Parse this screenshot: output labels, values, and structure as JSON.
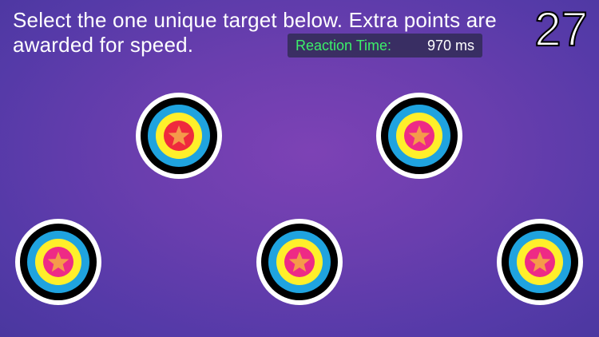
{
  "instructions": "Select the one unique target below. Extra points are awarded for speed.",
  "score": "27",
  "reaction": {
    "label": "Reaction Time:",
    "value": "970 ms"
  },
  "colors": {
    "ring_white": "#ffffff",
    "ring_black": "#000000",
    "ring_blue": "#1fa3df",
    "ring_yellow": "#ffef2a",
    "center_red": "#ef2a3d",
    "center_pink": "#ee2a86",
    "star_red": "#ef2a3d",
    "star_orange": "#f59a4a",
    "reaction_label": "#3cf06a"
  },
  "targets": [
    {
      "id": "target-1",
      "center": "center_red",
      "star": "star_orange",
      "unique": true
    },
    {
      "id": "target-2",
      "center": "center_pink",
      "star": "star_orange",
      "unique": false
    },
    {
      "id": "target-3",
      "center": "center_pink",
      "star": "star_orange",
      "unique": false
    },
    {
      "id": "target-4",
      "center": "center_pink",
      "star": "star_orange",
      "unique": false
    },
    {
      "id": "target-5",
      "center": "center_pink",
      "star": "star_orange",
      "unique": false
    }
  ]
}
